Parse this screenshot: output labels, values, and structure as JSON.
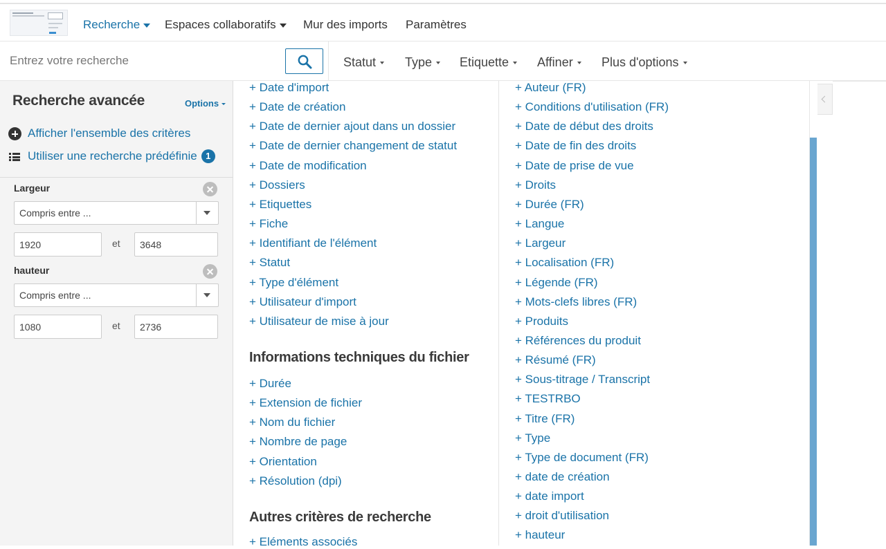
{
  "nav": {
    "items": [
      {
        "label": "Recherche",
        "active": true,
        "dropdown": true
      },
      {
        "label": "Espaces collaboratifs",
        "active": false,
        "dropdown": true
      },
      {
        "label": "Mur des imports",
        "active": false,
        "dropdown": false
      },
      {
        "label": "Paramètres",
        "active": false,
        "dropdown": false
      }
    ]
  },
  "search": {
    "placeholder": "Entrez votre recherche",
    "value": "",
    "button_icon": "search-icon"
  },
  "filters": [
    "Statut",
    "Type",
    "Etiquette",
    "Affiner",
    "Plus d'options"
  ],
  "sidebar": {
    "title": "Recherche avancée",
    "options_label": "Options",
    "show_all_label": "Afficher l'ensemble des critères",
    "predefined_label": "Utiliser une recherche prédéfinie",
    "predefined_badge": "1",
    "criteria": [
      {
        "label": "Largeur",
        "operator": "Compris entre ...",
        "from": "1920",
        "and_label": "et",
        "to": "3648"
      },
      {
        "label": "hauteur",
        "operator": "Compris entre ...",
        "from": "1080",
        "and_label": "et",
        "to": "2736"
      }
    ]
  },
  "columns": {
    "left": {
      "items_top": [
        "+ Date d'import",
        "+ Date de création",
        "+ Date de dernier ajout dans un dossier",
        "+ Date de dernier changement de statut",
        "+ Date de modification",
        "+ Dossiers",
        "+ Etiquettes",
        "+ Fiche",
        "+ Identifiant de l'élément",
        "+ Statut",
        "+ Type d'élément",
        "+ Utilisateur d'import",
        "+ Utilisateur de mise à jour"
      ],
      "section_tech_title": "Informations techniques du fichier",
      "items_tech": [
        "+ Durée",
        "+ Extension de fichier",
        "+ Nom du fichier",
        "+ Nombre de page",
        "+ Orientation",
        "+ Résolution (dpi)"
      ],
      "section_other_title": "Autres critères de recherche",
      "items_other": [
        "+ Eléments associés"
      ]
    },
    "right": {
      "items": [
        "+ Auteur (FR)",
        "+ Conditions d'utilisation (FR)",
        "+ Date de début des droits",
        "+ Date de fin des droits",
        "+ Date de prise de vue",
        "+ Droits",
        "+ Durée (FR)",
        "+ Langue",
        "+ Largeur",
        "+ Localisation (FR)",
        "+ Légende (FR)",
        "+ Mots-clefs libres (FR)",
        "+ Produits",
        "+ Références du produit",
        "+ Résumé (FR)",
        "+ Sous-titrage / Transcript",
        "+ TESTRBO",
        "+ Titre (FR)",
        "+ Type",
        "+ Type de document (FR)",
        "+ date de création",
        "+ date import",
        "+ droit d'utilisation",
        "+ hauteur"
      ]
    }
  },
  "colors": {
    "accent": "#1a73a8",
    "scrollbar": "#6aa6d0",
    "sidebar_bg": "#f4f4f4"
  }
}
